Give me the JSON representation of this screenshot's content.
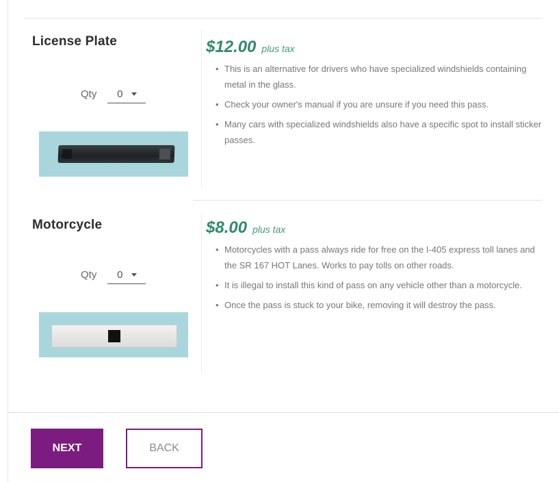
{
  "products": [
    {
      "name": "License Plate",
      "qty_label": "Qty",
      "qty_value": "0",
      "price": "$12.00",
      "tax_note": "plus tax",
      "image_name": "license-plate-pass",
      "bullets": [
        "This is an alternative for drivers who have specialized windshields containing metal in the glass.",
        "Check your owner's manual if you are unsure if you need this pass.",
        "Many cars with specialized windshields also have a specific spot to install sticker passes."
      ]
    },
    {
      "name": "Motorcycle",
      "qty_label": "Qty",
      "qty_value": "0",
      "price": "$8.00",
      "tax_note": "plus tax",
      "image_name": "motorcycle-pass",
      "bullets": [
        "Motorcycles with a pass always ride for free on the I-405 express toll lanes and the SR 167 HOT Lanes. Works to pay tolls on other roads.",
        "It is illegal to install this kind of pass on any vehicle other than a motorcycle.",
        "Once the pass is stuck to your bike, removing it will destroy the pass."
      ]
    }
  ],
  "buttons": {
    "next_label": "NEXT",
    "back_label": "BACK"
  },
  "colors": {
    "accent_purple": "#7c1c80",
    "price_green": "#2f8b6a",
    "image_bg": "#a9d6dc"
  }
}
